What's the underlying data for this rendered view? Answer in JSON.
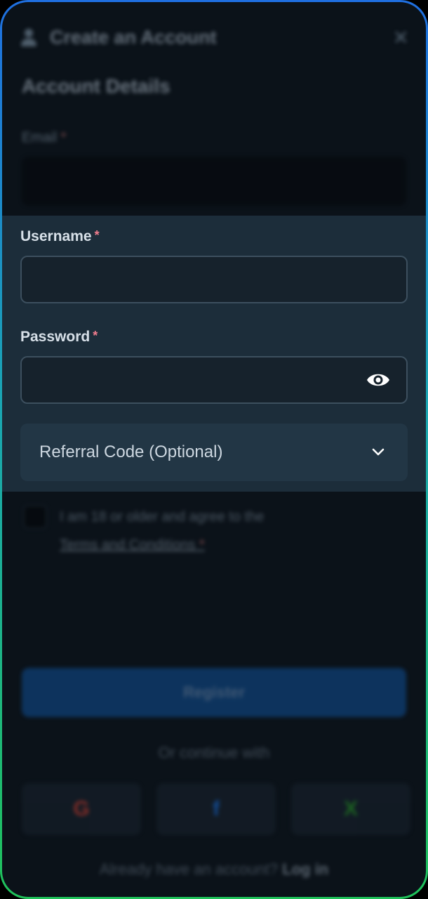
{
  "header": {
    "title": "Create an Account",
    "close_icon": "close-icon",
    "user_icon": "user-icon"
  },
  "section_title": "Account Details",
  "email": {
    "label": "Email",
    "required_mark": "*"
  },
  "username": {
    "label": "Username",
    "required_mark": "*",
    "value": ""
  },
  "password": {
    "label": "Password",
    "required_mark": "*",
    "value": "",
    "toggle_icon": "eye-icon"
  },
  "referral": {
    "label": "Referral Code (Optional)",
    "icon": "chevron-down-icon"
  },
  "terms": {
    "text": "I am 18 or older and agree to the",
    "link": "Terms and Conditions",
    "required_mark": "*"
  },
  "register_label": "Register",
  "or_text": "Or continue with",
  "social": [
    {
      "icon": "google-icon",
      "glyph": "G",
      "color": "#ea4335"
    },
    {
      "icon": "facebook-icon",
      "glyph": "f",
      "color": "#1877f2"
    },
    {
      "icon": "x-brand-icon",
      "glyph": "X",
      "color": "#2aa52a"
    }
  ],
  "login_prompt": "Already have an account?",
  "login_link": "Log in",
  "colors": {
    "accent_blue": "#0f4f96",
    "required": "#ef7d8d",
    "panel": "#1c2d3a"
  }
}
